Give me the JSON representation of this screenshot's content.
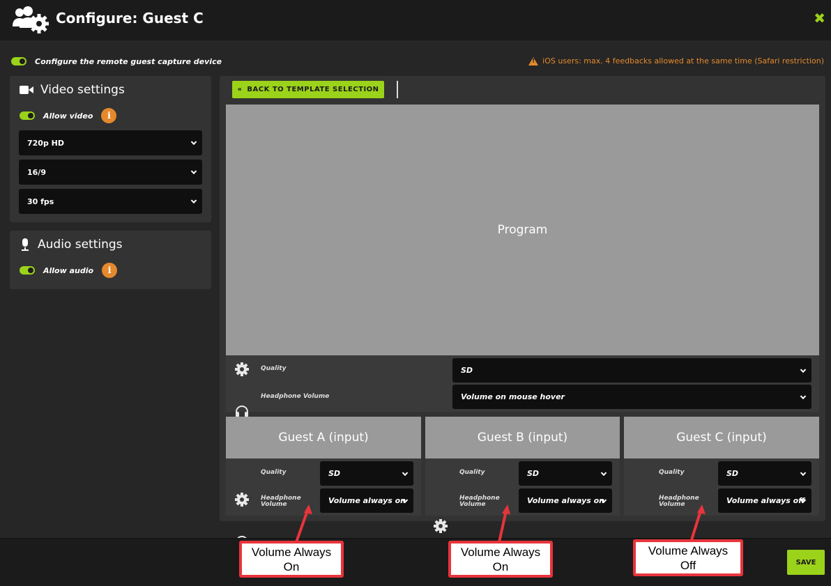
{
  "header": {
    "title": "Configure: Guest C",
    "close_glyph": "✖"
  },
  "remote": {
    "label": "Configure the remote guest capture device",
    "enabled": true
  },
  "ios_warning": "iOS users: max. 4 feedbacks allowed at the same time (Safari restriction)",
  "video": {
    "title": "Video settings",
    "allow_label": "Allow video",
    "allow_enabled": true,
    "info_glyph": "i",
    "resolution": "720p HD",
    "aspect": "16/9",
    "fps": "30 fps"
  },
  "audio": {
    "title": "Audio settings",
    "allow_label": "Allow audio",
    "allow_enabled": true,
    "info_glyph": "i"
  },
  "back_button": {
    "glyph": "«",
    "label": "BACK TO TEMPLATE SELECTION"
  },
  "program": {
    "label": "Program",
    "quality_label": "Quality",
    "quality_value": "SD",
    "headphone_label": "Headphone Volume",
    "headphone_value": "Volume on mouse hover"
  },
  "guests": [
    {
      "name": "Guest A (input)",
      "quality_label": "Quality",
      "quality_value": "SD",
      "headphone_label_1": "Headphone",
      "headphone_label_2": "Volume",
      "headphone_value": "Volume always on"
    },
    {
      "name": "Guest B (input)",
      "quality_label": "Quality",
      "quality_value": "SD",
      "headphone_label_1": "Headphone",
      "headphone_label_2": "Volume",
      "headphone_value": "Volume always on"
    },
    {
      "name": "Guest C (input)",
      "quality_label": "Quality",
      "quality_value": "SD",
      "headphone_label_1": "Headphone",
      "headphone_label_2": "Volume",
      "headphone_value": "Volume always off"
    }
  ],
  "save_label": "SAVE",
  "annotations": [
    {
      "line1": "Volume Always",
      "line2": "On"
    },
    {
      "line1": "Volume Always",
      "line2": "On"
    },
    {
      "line1": "Volume Always",
      "line2": "Off"
    }
  ],
  "colors": {
    "accent": "#9bd21a",
    "warning": "#e4892c",
    "annotation": "#e8343c"
  },
  "icons": [
    "users-gear-icon",
    "close-icon",
    "warning-icon",
    "camera-icon",
    "microphone-icon",
    "info-icon",
    "gear-icon",
    "headphones-icon",
    "chevron-down-icon",
    "double-chevron-left-icon"
  ]
}
